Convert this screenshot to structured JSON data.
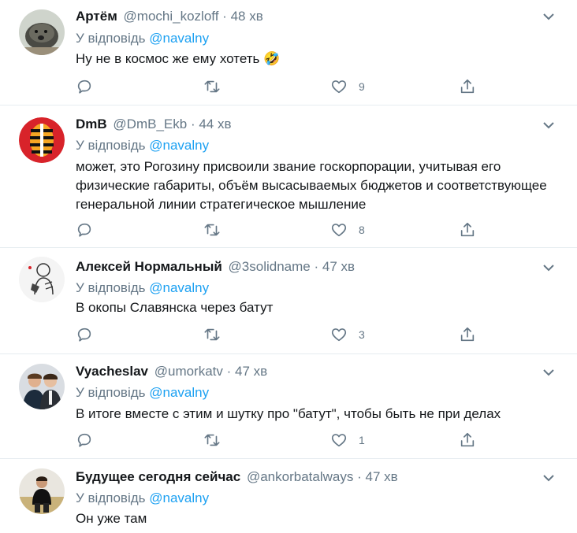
{
  "tweets": [
    {
      "author": "Артём",
      "handle": "@mochi_kozloff",
      "time": "48 хв",
      "reply_prefix": "У відповідь",
      "reply_to": "@navalny",
      "text": "Ну не в космос же ему хотеть 🤣",
      "likes": "9",
      "avatar_icon": "hedgehog-avatar-icon"
    },
    {
      "author": "DmB",
      "handle": "@DmB_Ekb",
      "time": "44 хв",
      "reply_prefix": "У відповідь",
      "reply_to": "@navalny",
      "text": "может, это Рогозину присвоили звание госкорпорации, учитывая его физические габариты, объём высасываемых бюджетов и соответствующее генеральной линии стратегическое мышление",
      "likes": "8",
      "avatar_icon": "st-george-ribbon-avatar-icon"
    },
    {
      "author": "Алексей Нормальный",
      "handle": "@3solidname",
      "time": "47 хв",
      "reply_prefix": "У відповідь",
      "reply_to": "@navalny",
      "text": "В окопы Славянска через батут",
      "likes": "3",
      "avatar_icon": "sketch-avatar-icon"
    },
    {
      "author": "Vyacheslav",
      "handle": "@umorkatv",
      "time": "47 хв",
      "reply_prefix": "У відповідь",
      "reply_to": "@navalny",
      "text": "В итоге вместе с этим и шутку про \"батут\", чтобы быть не при делах",
      "likes": "1",
      "avatar_icon": "two-people-avatar-icon"
    },
    {
      "author": "Будущее сегодня сейчас",
      "handle": "@ankorbatalways",
      "time": "47 хв",
      "reply_prefix": "У відповідь",
      "reply_to": "@navalny",
      "text": "Он уже там",
      "likes": "",
      "avatar_icon": "person-photo-avatar-icon"
    }
  ],
  "separator": "·",
  "colors": {
    "accent": "#1da1f2",
    "secondary_text": "#657786",
    "primary_text": "#14171a",
    "divider": "#e6ecf0"
  },
  "icons": {
    "more": "chevron-down-icon",
    "reply": "reply-bubble-icon",
    "retweet": "retweet-icon",
    "like": "heart-icon",
    "share": "share-icon"
  }
}
